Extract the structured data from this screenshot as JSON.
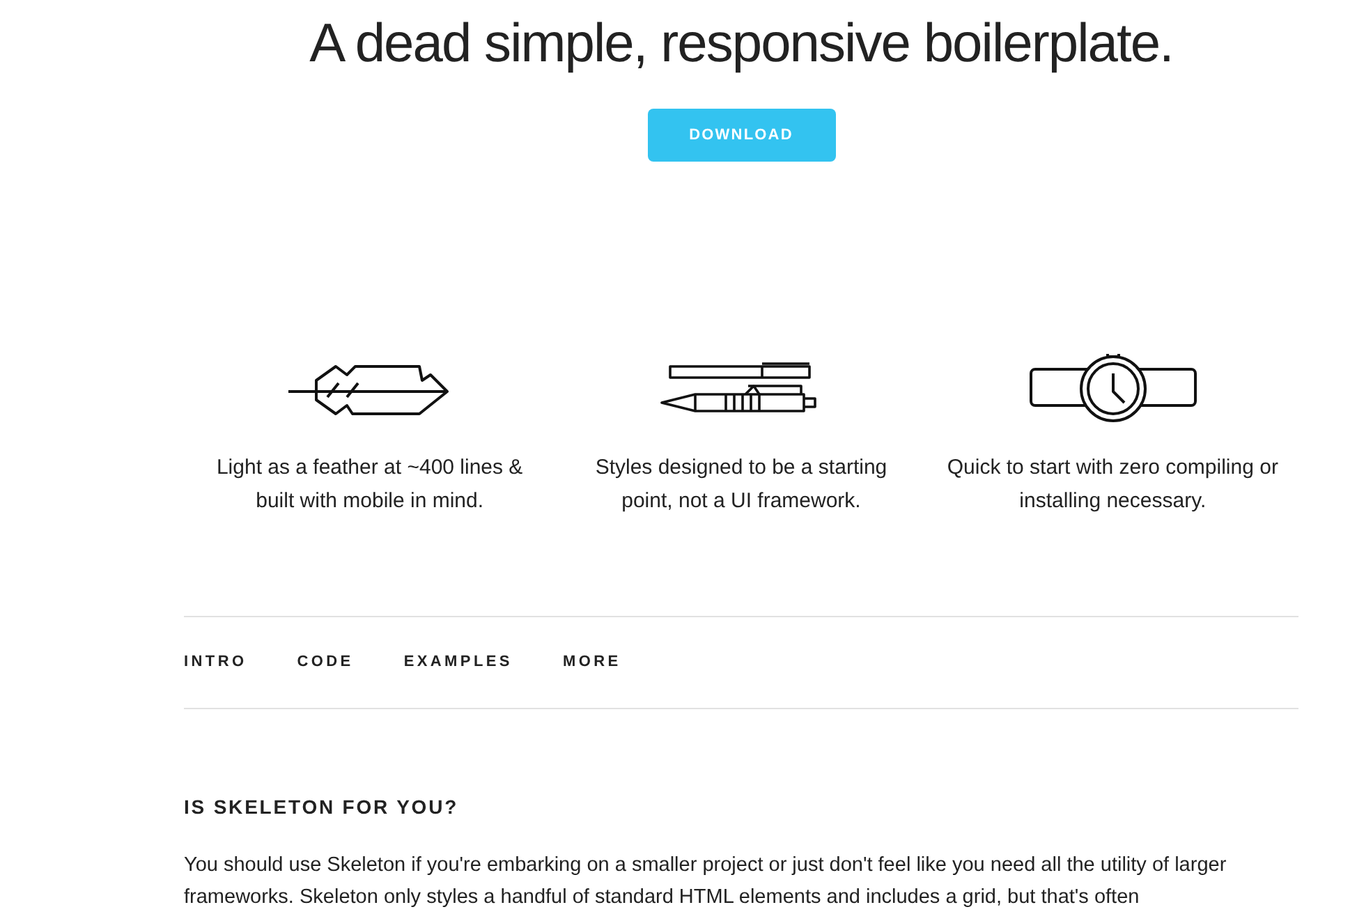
{
  "hero": {
    "title": "A dead simple, responsive boilerplate.",
    "button": "DOWNLOAD"
  },
  "features": [
    {
      "kind": "feather",
      "text": "Light as a feather at ~400 lines & built with mobile in mind."
    },
    {
      "kind": "pens",
      "text": "Styles designed to be a starting point, not a UI framework."
    },
    {
      "kind": "watch",
      "text": "Quick to start with zero compiling or installing necessary."
    }
  ],
  "nav": [
    {
      "label": "INTRO"
    },
    {
      "label": "CODE"
    },
    {
      "label": "EXAMPLES"
    },
    {
      "label": "MORE"
    }
  ],
  "section": {
    "heading": "IS SKELETON FOR YOU?",
    "paragraph": "You should use Skeleton if you're embarking on a smaller project or just don't feel like you need all the utility of larger frameworks. Skeleton only styles a handful of standard HTML elements and includes a grid, but that's often"
  }
}
